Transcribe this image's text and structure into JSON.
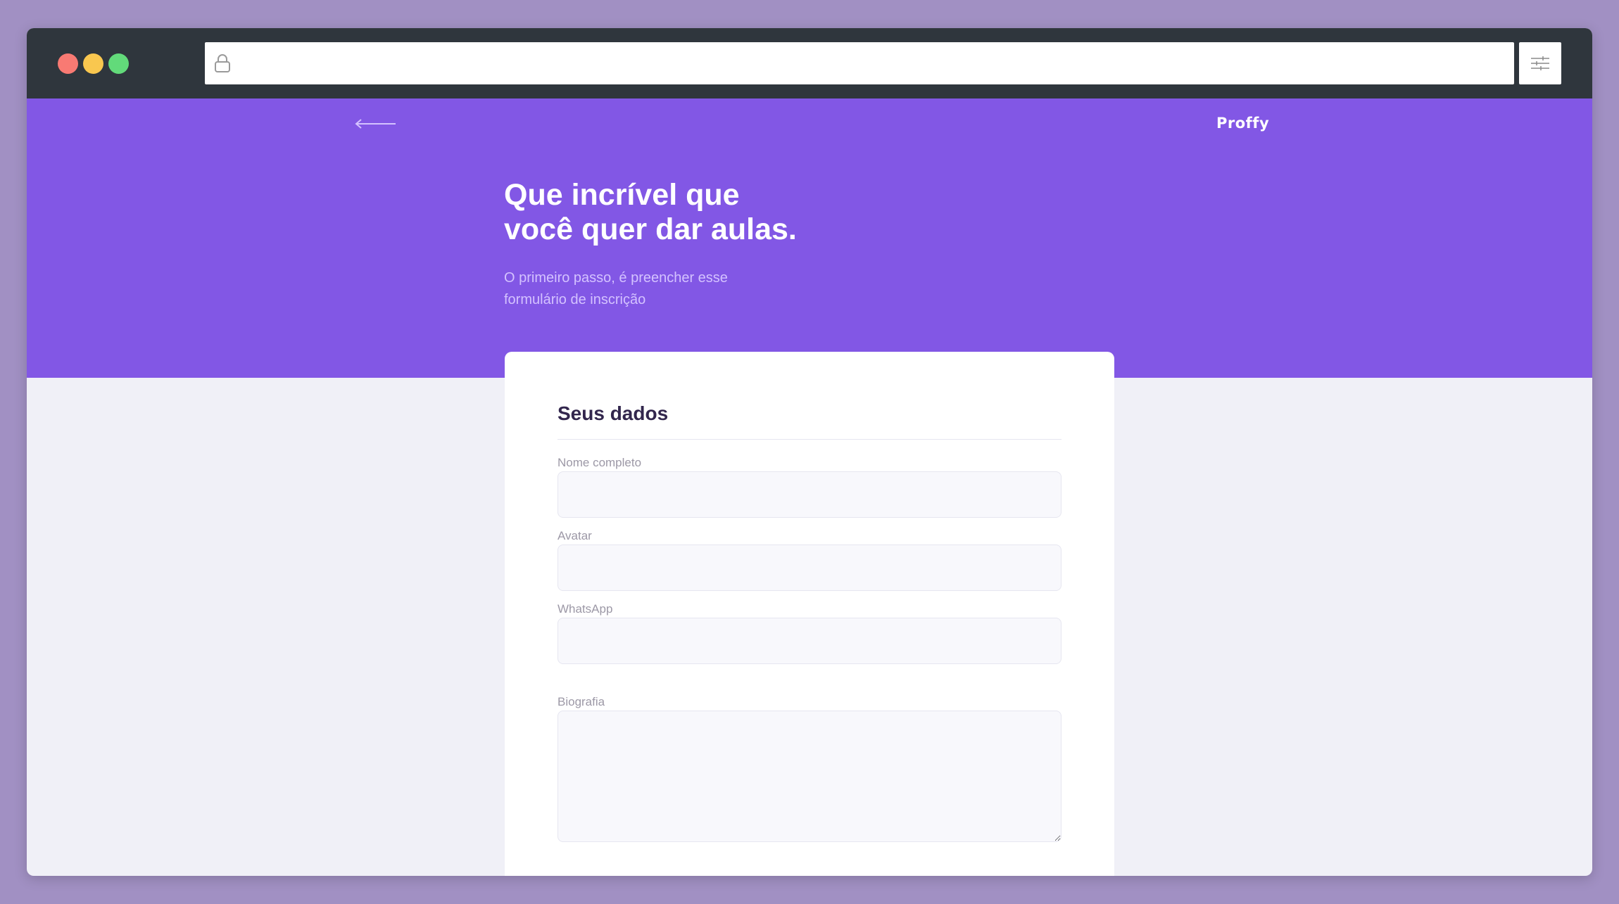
{
  "browser": {
    "url": "",
    "icons": {
      "lock": "lock-icon",
      "settings": "sliders-icon"
    },
    "colors": {
      "close": "#f87a73",
      "minimize": "#f9c74f",
      "maximize": "#62da7a",
      "titlebar": "#2f363d"
    }
  },
  "header": {
    "back_icon": "arrow-left-icon",
    "brand": "Proffy",
    "title_line1": "Que incrível que",
    "title_line2": "você quer dar aulas.",
    "subtitle_line1": "O primeiro passo, é preencher esse",
    "subtitle_line2": "formulário de inscrição",
    "background": "#8257e5"
  },
  "form": {
    "legend": "Seus dados",
    "fields": [
      {
        "label": "Nome completo",
        "value": ""
      },
      {
        "label": "Avatar",
        "value": ""
      },
      {
        "label": "WhatsApp",
        "value": ""
      },
      {
        "label": "Biografia",
        "value": ""
      }
    ]
  }
}
